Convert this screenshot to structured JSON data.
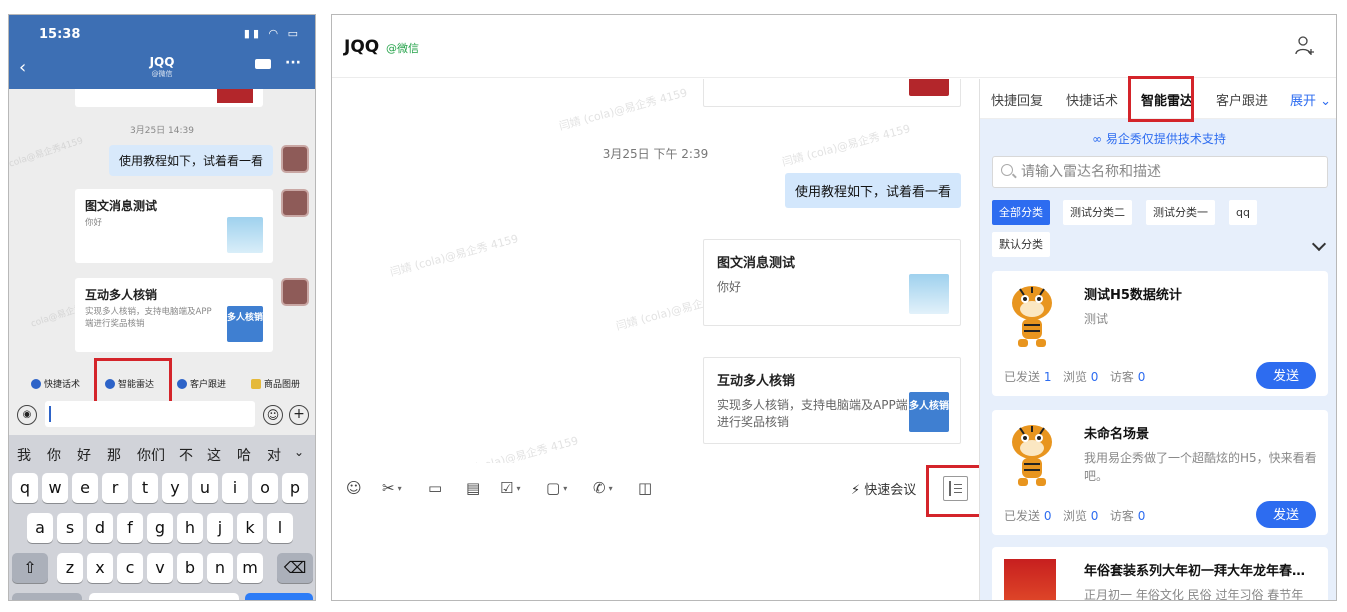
{
  "phone": {
    "time": "15:38",
    "title": "JQQ",
    "subtitle": "@微信",
    "date": "3月25日 14:39",
    "bubble": "使用教程如下，试着看一看",
    "card1": {
      "title": "图文消息测试",
      "desc": "你好"
    },
    "card2": {
      "title": "互动多人核销",
      "desc": "实现多人核销，支持电脑端及APP端进行奖品核销",
      "thumb": "多人核销"
    },
    "tools": [
      "快捷话术",
      "智能雷达",
      "客户跟进",
      "商品图册"
    ],
    "candidates": [
      "我",
      "你",
      "好",
      "那",
      "你们",
      "不",
      "这",
      "哈",
      "对"
    ],
    "row1": [
      "q",
      "w",
      "e",
      "r",
      "t",
      "y",
      "u",
      "i",
      "o",
      "p"
    ],
    "row2": [
      "a",
      "s",
      "d",
      "f",
      "g",
      "h",
      "j",
      "k",
      "l"
    ],
    "row3": [
      "z",
      "x",
      "c",
      "v",
      "b",
      "n",
      "m"
    ]
  },
  "desktop": {
    "contact": "JQQ",
    "source": "@微信",
    "chat": {
      "date": "3月25日 下午 2:39",
      "bubble": "使用教程如下，试着看一看",
      "card1": {
        "title": "图文消息测试",
        "desc": "你好"
      },
      "card2": {
        "title": "互动多人核销",
        "desc": "实现多人核销，支持电脑端及APP端进行奖品核销",
        "thumb": "多人核销"
      },
      "watermark": "闫婧 (cola)@易企秀 4159"
    },
    "toolbar": {
      "quick_meeting": "快速会议"
    },
    "panel": {
      "tabs": [
        "快捷回复",
        "快捷话术",
        "智能雷达",
        "客户跟进"
      ],
      "expand": "展开",
      "support": "易企秀仅提供技术支持",
      "search_placeholder": "请输入雷达名称和描述",
      "chips": [
        "全部分类",
        "测试分类二",
        "测试分类一",
        "qq",
        "默认分类"
      ],
      "cards": [
        {
          "title": "测试H5数据统计",
          "desc": "测试",
          "sent_label": "已发送",
          "sent": "1",
          "views_label": "浏览",
          "views": "0",
          "visitors_label": "访客",
          "visitors": "0",
          "send": "发送"
        },
        {
          "title": "未命名场景",
          "desc": "我用易企秀做了一个超酷炫的H5，快来看看吧。",
          "sent_label": "已发送",
          "sent": "0",
          "views_label": "浏览",
          "views": "0",
          "visitors_label": "访客",
          "visitors": "0",
          "send": "发送"
        },
        {
          "title": "年俗套装系列大年初一拜大年龙年春…",
          "desc": "正月初一 年俗文化 民俗 过年习俗 春节年"
        }
      ]
    }
  }
}
